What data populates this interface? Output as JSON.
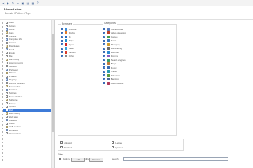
{
  "header": {
    "title": "Allowed sites",
    "subtitle": "Domain / Pattern / Type"
  },
  "toolbar": {
    "icons": [
      "back-icon",
      "forward-icon",
      "refresh-icon",
      "home-icon",
      "save-icon",
      "print-icon",
      "grid-icon",
      "help-icon"
    ]
  },
  "sidebar": {
    "items": [
      {
        "label": "Audit"
      },
      {
        "label": "Actions"
      },
      {
        "label": "Alerts"
      },
      {
        "label": "Apps"
      },
      {
        "label": "Content"
      },
      {
        "label": "Computer info"
      },
      {
        "label": "Control"
      },
      {
        "label": "Downloads"
      },
      {
        "label": "Email"
      },
      {
        "label": "Events"
      },
      {
        "label": "File"
      },
      {
        "label": "File history"
      },
      {
        "label": "Live monitoring"
      },
      {
        "label": "Network"
      },
      {
        "label": "Port scan"
      },
      {
        "label": "Printers"
      },
      {
        "label": "Process"
      },
      {
        "label": "Registry"
      },
      {
        "label": "Remote sessions"
      },
      {
        "label": "Screenshots"
      },
      {
        "label": "Services"
      },
      {
        "label": "Settings"
      },
      {
        "label": "Shared folders"
      },
      {
        "label": "Software"
      },
      {
        "label": "Startup"
      },
      {
        "label": "System"
      },
      {
        "label": "Web",
        "selected": true
      },
      {
        "label": "Web history"
      },
      {
        "label": "Web sites"
      },
      {
        "label": "Updates"
      },
      {
        "label": "Users"
      },
      {
        "label": "USB devices"
      },
      {
        "label": "Windows"
      },
      {
        "label": "Workstations"
      }
    ]
  },
  "main": {
    "group1": {
      "title": "Browsers",
      "options": [
        {
          "label": "Chrome",
          "checked": true,
          "icon_color": "#3a8bd8"
        },
        {
          "label": "Firefox",
          "checked": true,
          "icon_color": "#e07a2a"
        },
        {
          "label": "IE",
          "checked": true,
          "icon_color": "#2a6ec0"
        },
        {
          "label": "Edge",
          "checked": true,
          "icon_color": "#1f8fd0"
        },
        {
          "label": "Opera",
          "checked": true,
          "icon_color": "#cc2a2a"
        },
        {
          "label": "Safari",
          "checked": true,
          "icon_color": "#3aa0d8"
        },
        {
          "label": "Yandex",
          "checked": true,
          "icon_color": "#d83a2a"
        },
        {
          "label": "Other",
          "checked": true,
          "icon_color": "#8a8a8a"
        }
      ]
    },
    "group2": {
      "title": "Categories",
      "options": [
        {
          "label": "Social media",
          "checked": true,
          "icon_color": "#5a7fc0"
        },
        {
          "label": "Video streaming",
          "checked": true,
          "icon_color": "#c0402a"
        },
        {
          "label": "Games",
          "checked": true,
          "icon_color": "#4aa04a"
        },
        {
          "label": "News",
          "checked": true,
          "icon_color": "#3a7ac0"
        },
        {
          "label": "Shopping",
          "checked": true,
          "icon_color": "#d09a2a"
        },
        {
          "label": "File sharing",
          "checked": true,
          "icon_color": "#6a6a6a"
        },
        {
          "label": "Webmail",
          "checked": true,
          "icon_color": "#2a8ad0"
        },
        {
          "label": "Forums",
          "checked": true,
          "icon_color": "#8a5ac0"
        },
        {
          "label": "Search engines",
          "checked": true,
          "icon_color": "#3aa06a"
        },
        {
          "label": "Blogs",
          "checked": true,
          "icon_color": "#c07a3a"
        },
        {
          "label": "Music",
          "checked": true,
          "icon_color": "#3a6ab0"
        },
        {
          "label": "Travel",
          "checked": true,
          "icon_color": "#2a9ab0"
        },
        {
          "label": "Education",
          "checked": true,
          "icon_color": "#5a9a3a"
        },
        {
          "label": "Banking",
          "checked": true,
          "icon_color": "#4a6a9a"
        },
        {
          "label": "Adult content",
          "checked": true,
          "icon_color": "#b03a5a"
        }
      ]
    },
    "sub": {
      "options": [
        {
          "label": "Allowed",
          "checked": false
        },
        {
          "label": "Blocked",
          "checked": false
        },
        {
          "label": "Logged",
          "checked": false
        },
        {
          "label": "Ignored",
          "checked": false
        }
      ]
    },
    "bottom": {
      "title": "Filter",
      "row_label": "Apply to all computers in the group",
      "search_label": "Search",
      "search_value": "",
      "buttons": [
        "Add",
        "Remove"
      ]
    }
  }
}
